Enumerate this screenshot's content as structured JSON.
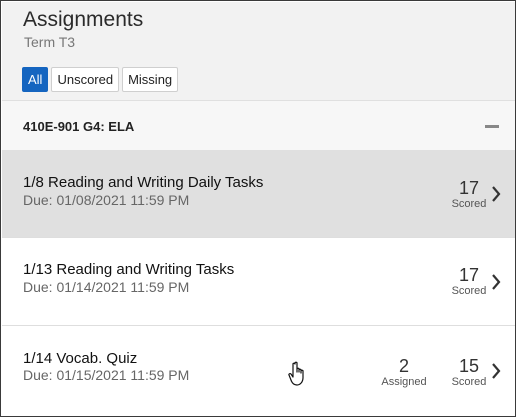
{
  "header": {
    "title": "Assignments",
    "term": "Term T3"
  },
  "filters": [
    {
      "label": "All",
      "active": true
    },
    {
      "label": "Unscored",
      "active": false
    },
    {
      "label": "Missing",
      "active": false
    }
  ],
  "section": {
    "title": "410E-901 G4: ELA",
    "collapse_icon": "minus-icon"
  },
  "assignments": [
    {
      "name": "1/8 Reading and Writing Daily Tasks",
      "due": "Due: 01/08/2021 11:59 PM",
      "scored_count": "17",
      "scored_label": "Scored"
    },
    {
      "name": "1/13 Reading and Writing Tasks",
      "due": "Due: 01/14/2021 11:59 PM",
      "scored_count": "17",
      "scored_label": "Scored"
    },
    {
      "name": "1/14 Vocab. Quiz",
      "due": "Due: 01/15/2021 11:59 PM",
      "assigned_count": "2",
      "assigned_label": "Assigned",
      "scored_count": "15",
      "scored_label": "Scored"
    }
  ],
  "colors": {
    "accent": "#1565c0",
    "header_bg": "#f2f2f2",
    "row_hover": "#e0e0e0"
  },
  "icons": {
    "row_arrow": "chevron-right-icon",
    "cursor": "hand-pointer-icon"
  }
}
